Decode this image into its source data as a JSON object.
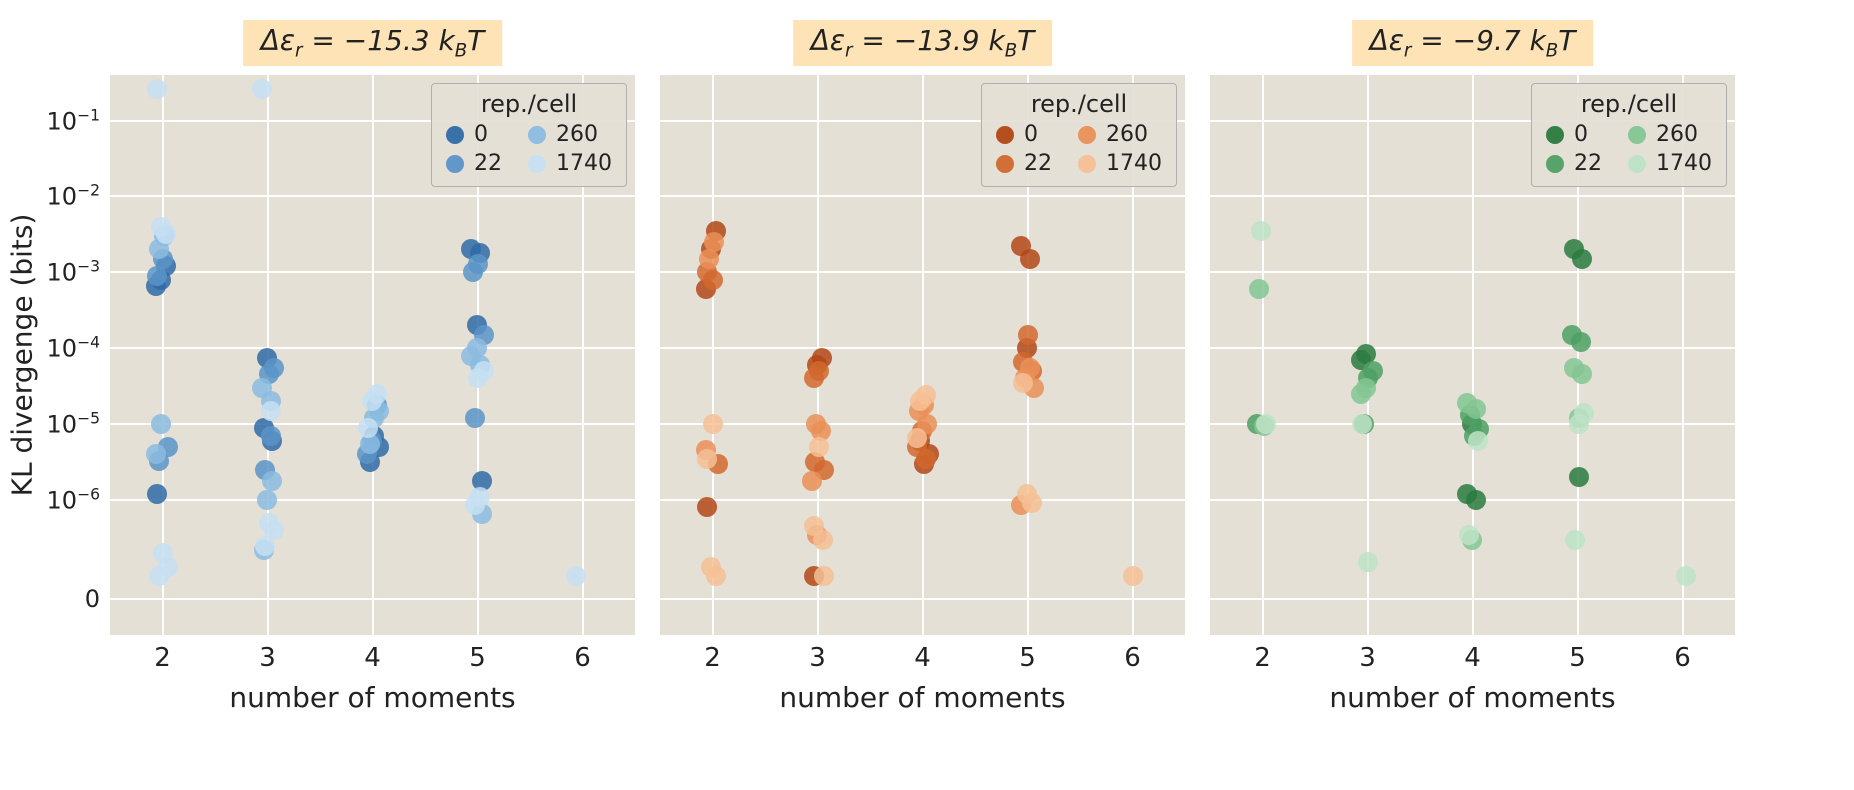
{
  "chart_data": [
    {
      "type": "scatter",
      "title_prefix": "Δε",
      "title_sub": "r",
      "title_value": " = −15.3 ",
      "title_unit_k": "k",
      "title_unit_sub": "B",
      "title_unit_T": "T",
      "xlabel": "number of moments",
      "ylabel": "KL divergenge (bits)",
      "x_ticks": [
        2,
        3,
        4,
        5,
        6
      ],
      "y_ticks_exp": [
        -6,
        -5,
        -4,
        -3,
        -2,
        -1
      ],
      "y_zero_label": "0",
      "ylim_exp": [
        -7.3,
        -0.4
      ],
      "y_zero_frac": 0.935,
      "colors": {
        "0": "#2f6aa7",
        "22": "#5a94c8",
        "260": "#8bbbe0",
        "1740": "#c6dff2"
      },
      "legend": {
        "title": "rep./cell",
        "items": [
          "0",
          "22",
          "260",
          "1740"
        ]
      },
      "series": [
        {
          "name": "0",
          "points": [
            [
              2,
              0.00065
            ],
            [
              2,
              0.0008
            ],
            [
              2,
              0.0012
            ],
            [
              2,
              1.2e-06
            ],
            [
              3,
              7.5e-05
            ],
            [
              3,
              6e-06
            ],
            [
              3,
              9e-06
            ],
            [
              4,
              7e-06
            ],
            [
              4,
              5e-06
            ],
            [
              4,
              3.2e-06
            ],
            [
              5,
              0.0018
            ],
            [
              5,
              0.002
            ],
            [
              5,
              0.0002
            ],
            [
              5,
              1.8e-06
            ]
          ]
        },
        {
          "name": "22",
          "points": [
            [
              2,
              0.0009
            ],
            [
              2,
              0.0015
            ],
            [
              2,
              5e-06
            ],
            [
              2,
              3.3e-06
            ],
            [
              3,
              4.5e-05
            ],
            [
              3,
              5.5e-05
            ],
            [
              3,
              2.5e-06
            ],
            [
              3,
              7e-06
            ],
            [
              4,
              4e-06
            ],
            [
              4,
              6e-06
            ],
            [
              4,
              1.8e-05
            ],
            [
              5,
              0.001
            ],
            [
              5,
              0.0013
            ],
            [
              5,
              0.00015
            ],
            [
              5,
              1.2e-05
            ]
          ]
        },
        {
          "name": "260",
          "points": [
            [
              2,
              0.002
            ],
            [
              2,
              0.003
            ],
            [
              2,
              4e-06
            ],
            [
              2,
              1e-05
            ],
            [
              3,
              2e-05
            ],
            [
              3,
              3e-05
            ],
            [
              3,
              1e-06
            ],
            [
              3,
              1.8e-06
            ],
            [
              3,
              2.2e-07
            ],
            [
              4,
              1.2e-05
            ],
            [
              4,
              1.5e-05
            ],
            [
              4,
              5.5e-06
            ],
            [
              5,
              6e-05
            ],
            [
              5,
              8e-05
            ],
            [
              5,
              0.0001
            ],
            [
              5,
              6.5e-07
            ]
          ]
        },
        {
          "name": "1740",
          "points": [
            [
              2,
              0.004
            ],
            [
              2,
              0.0032
            ],
            [
              2,
              0.26
            ],
            [
              2,
              2e-07
            ],
            [
              2,
              1.3e-07
            ],
            [
              2,
              1e-07
            ],
            [
              3,
              5e-07
            ],
            [
              3,
              4e-07
            ],
            [
              3,
              2.5e-07
            ],
            [
              3,
              1.5e-05
            ],
            [
              3,
              0.26
            ],
            [
              4,
              2e-05
            ],
            [
              4,
              2.5e-05
            ],
            [
              4,
              9e-06
            ],
            [
              5,
              4e-05
            ],
            [
              5,
              5e-05
            ],
            [
              5,
              8.5e-07
            ],
            [
              5,
              1.1e-06
            ],
            [
              6,
              1e-07
            ]
          ]
        }
      ]
    },
    {
      "type": "scatter",
      "title_prefix": "Δε",
      "title_sub": "r",
      "title_value": " = −13.9 ",
      "title_unit_k": "k",
      "title_unit_sub": "B",
      "title_unit_T": "T",
      "xlabel": "number of moments",
      "ylabel": "",
      "x_ticks": [
        2,
        3,
        4,
        5,
        6
      ],
      "y_ticks_exp": [
        -6,
        -5,
        -4,
        -3,
        -2,
        -1
      ],
      "y_zero_label": "0",
      "ylim_exp": [
        -7.3,
        -0.4
      ],
      "y_zero_frac": 0.935,
      "colors": {
        "0": "#b34716",
        "22": "#d1682e",
        "260": "#ea8f57",
        "1740": "#f6bf95"
      },
      "legend": {
        "title": "rep./cell",
        "items": [
          "0",
          "22",
          "260",
          "1740"
        ]
      },
      "series": [
        {
          "name": "0",
          "points": [
            [
              2,
              0.0006
            ],
            [
              2,
              0.002
            ],
            [
              2,
              0.0035
            ],
            [
              2,
              8e-07
            ],
            [
              3,
              6e-05
            ],
            [
              3,
              7.5e-05
            ],
            [
              3,
              1e-07
            ],
            [
              4,
              3e-06
            ],
            [
              4,
              4e-06
            ],
            [
              4,
              6e-06
            ],
            [
              5,
              0.0015
            ],
            [
              5,
              0.0022
            ],
            [
              5,
              0.0001
            ]
          ]
        },
        {
          "name": "22",
          "points": [
            [
              2,
              0.001
            ],
            [
              2,
              0.0008
            ],
            [
              2,
              3e-06
            ],
            [
              3,
              4e-05
            ],
            [
              3,
              5e-05
            ],
            [
              3,
              2.5e-06
            ],
            [
              3,
              3.2e-06
            ],
            [
              4,
              3.5e-06
            ],
            [
              4,
              5e-06
            ],
            [
              4,
              8e-06
            ],
            [
              5,
              5e-05
            ],
            [
              5,
              6.5e-05
            ],
            [
              5,
              0.00015
            ]
          ]
        },
        {
          "name": "260",
          "points": [
            [
              2,
              0.0015
            ],
            [
              2,
              0.0025
            ],
            [
              2,
              4.5e-06
            ],
            [
              3,
              1e-05
            ],
            [
              3,
              8e-06
            ],
            [
              3,
              1.8e-06
            ],
            [
              3,
              3.5e-07
            ],
            [
              4,
              1e-05
            ],
            [
              4,
              1.5e-05
            ],
            [
              4,
              1.8e-05
            ],
            [
              5,
              3e-05
            ],
            [
              5,
              4e-05
            ],
            [
              5,
              5.5e-05
            ],
            [
              5,
              8.5e-07
            ]
          ]
        },
        {
          "name": "1740",
          "points": [
            [
              2,
              1.3e-07
            ],
            [
              2,
              1e-07
            ],
            [
              2,
              3.5e-06
            ],
            [
              2,
              1e-05
            ],
            [
              3,
              3e-07
            ],
            [
              3,
              4.5e-07
            ],
            [
              3,
              5e-06
            ],
            [
              3,
              1e-07
            ],
            [
              4,
              2e-05
            ],
            [
              4,
              2.4e-05
            ],
            [
              4,
              6.5e-06
            ],
            [
              5,
              1.2e-06
            ],
            [
              5,
              9e-07
            ],
            [
              5,
              3.5e-05
            ],
            [
              6,
              1e-07
            ]
          ]
        }
      ]
    },
    {
      "type": "scatter",
      "title_prefix": "Δε",
      "title_sub": "r",
      "title_value": " = −9.7 ",
      "title_unit_k": "k",
      "title_unit_sub": "B",
      "title_unit_T": "T",
      "xlabel": "number of moments",
      "ylabel": "",
      "x_ticks": [
        2,
        3,
        4,
        5,
        6
      ],
      "y_ticks_exp": [
        -6,
        -5,
        -4,
        -3,
        -2,
        -1
      ],
      "y_zero_label": "0",
      "ylim_exp": [
        -7.3,
        -0.4
      ],
      "y_zero_frac": 0.935,
      "colors": {
        "0": "#2a7a3f",
        "22": "#4ea064",
        "260": "#83c592",
        "1740": "#bde3c6"
      },
      "legend": {
        "title": "rep./cell",
        "items": [
          "0",
          "22",
          "260",
          "1740"
        ]
      },
      "series": [
        {
          "name": "0",
          "points": [
            [
              3,
              7e-05
            ],
            [
              3,
              8.5e-05
            ],
            [
              4,
              1e-06
            ],
            [
              4,
              1.2e-06
            ],
            [
              4,
              1e-05
            ],
            [
              5,
              0.0015
            ],
            [
              5,
              0.002
            ],
            [
              5,
              2e-06
            ]
          ]
        },
        {
          "name": "22",
          "points": [
            [
              2,
              1e-05
            ],
            [
              3,
              4e-05
            ],
            [
              3,
              5e-05
            ],
            [
              3,
              1e-05
            ],
            [
              4,
              7e-06
            ],
            [
              4,
              8.5e-06
            ],
            [
              4,
              1.3e-05
            ],
            [
              5,
              0.00012
            ],
            [
              5,
              0.00015
            ]
          ]
        },
        {
          "name": "260",
          "points": [
            [
              2,
              0.0006
            ],
            [
              2,
              9.5e-06
            ],
            [
              3,
              2.5e-05
            ],
            [
              3,
              3e-05
            ],
            [
              4,
              1.6e-05
            ],
            [
              4,
              1.9e-05
            ],
            [
              4,
              3e-07
            ],
            [
              5,
              4.5e-05
            ],
            [
              5,
              5.5e-05
            ],
            [
              5,
              1.2e-05
            ]
          ]
        },
        {
          "name": "1740",
          "points": [
            [
              2,
              0.0035
            ],
            [
              2,
              1e-05
            ],
            [
              3,
              1e-05
            ],
            [
              3,
              1.5e-07
            ],
            [
              4,
              6e-06
            ],
            [
              4,
              3.5e-07
            ],
            [
              5,
              1e-05
            ],
            [
              5,
              1.4e-05
            ],
            [
              5,
              3e-07
            ],
            [
              6,
              1e-07
            ]
          ]
        }
      ]
    }
  ]
}
